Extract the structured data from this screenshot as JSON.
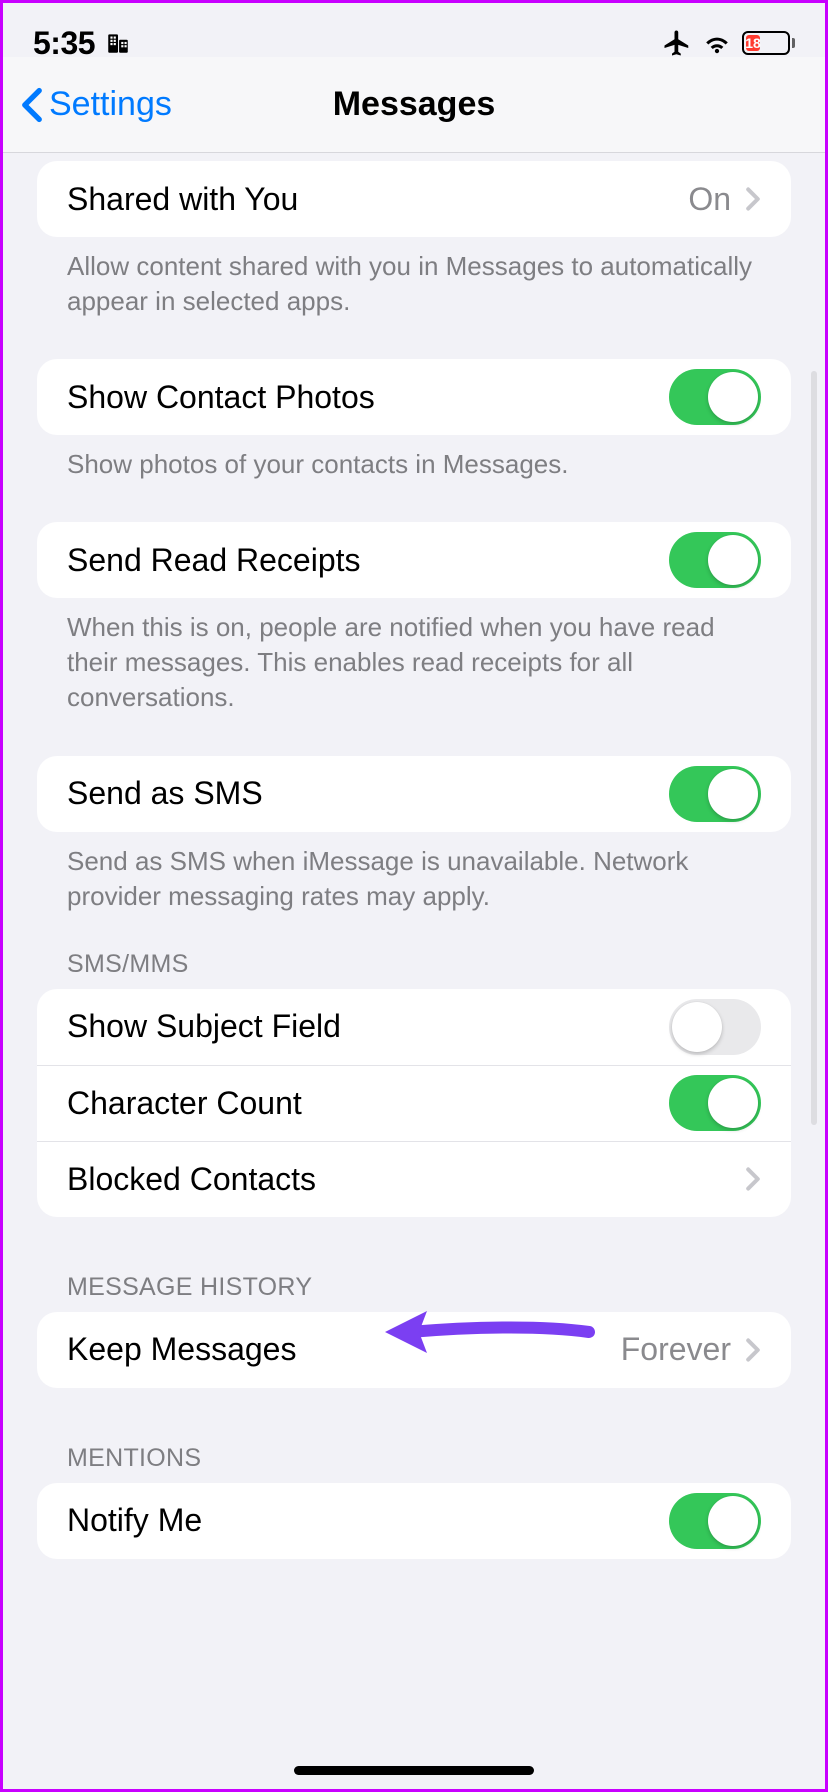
{
  "status": {
    "time": "5:35",
    "battery": "18"
  },
  "nav": {
    "back": "Settings",
    "title": "Messages"
  },
  "rows": {
    "shared": {
      "label": "Shared with You",
      "value": "On"
    },
    "shared_footer": "Allow content shared with you in Messages to automatically appear in selected apps.",
    "photos": {
      "label": "Show Contact Photos"
    },
    "photos_footer": "Show photos of your contacts in Messages.",
    "receipts": {
      "label": "Send Read Receipts"
    },
    "receipts_footer": "When this is on, people are notified when you have read their messages. This enables read receipts for all conversations.",
    "sms": {
      "label": "Send as SMS"
    },
    "sms_footer": "Send as SMS when iMessage is unavailable. Network provider messaging rates may apply.",
    "smsmms_header": "SMS/MMS",
    "subject": {
      "label": "Show Subject Field"
    },
    "charcount": {
      "label": "Character Count"
    },
    "blocked": {
      "label": "Blocked Contacts"
    },
    "history_header": "MESSAGE HISTORY",
    "keep": {
      "label": "Keep Messages",
      "value": "Forever"
    },
    "mentions_header": "MENTIONS",
    "notify": {
      "label": "Notify Me"
    }
  },
  "toggles": {
    "photos": true,
    "receipts": true,
    "sms": true,
    "subject": false,
    "charcount": true,
    "notify": true
  }
}
